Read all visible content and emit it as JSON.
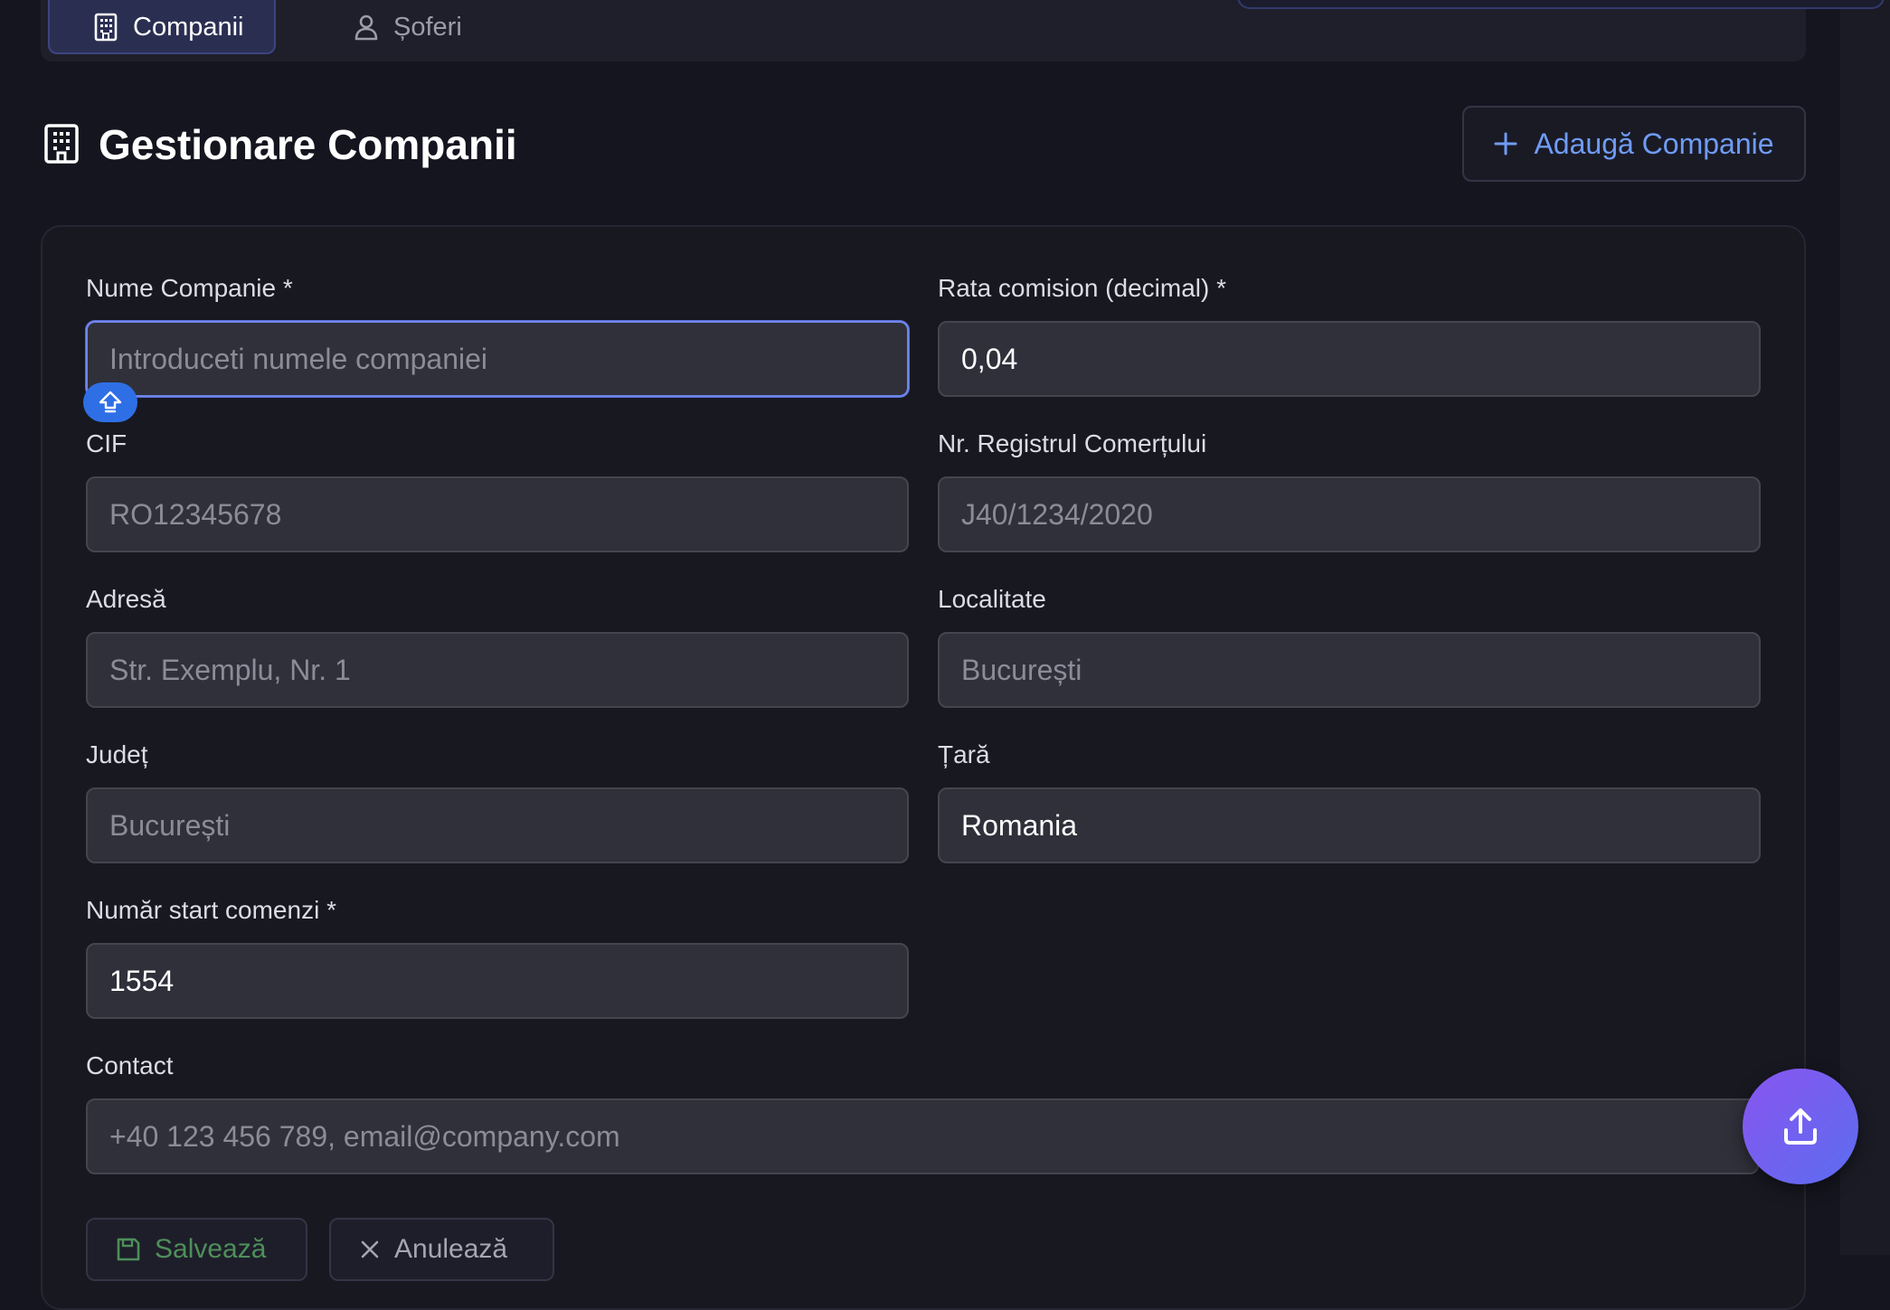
{
  "tabs": [
    {
      "label": "Companii",
      "icon": "building-icon",
      "active": true
    },
    {
      "label": "Șoferi",
      "icon": "user-icon",
      "active": false
    }
  ],
  "header": {
    "title": "Gestionare Companii",
    "icon": "building-icon",
    "add_button_label": "Adaugă Companie"
  },
  "form": {
    "company_name": {
      "label": "Nume Companie *",
      "value": "",
      "placeholder": "Introduceti numele companiei"
    },
    "commission_rate": {
      "label": "Rata comision (decimal) *",
      "value": "0,04",
      "placeholder": ""
    },
    "cif": {
      "label": "CIF",
      "value": "",
      "placeholder": "RO12345678"
    },
    "trade_register": {
      "label": "Nr. Registrul Comerțului",
      "value": "",
      "placeholder": "J40/1234/2020"
    },
    "address": {
      "label": "Adresă",
      "value": "",
      "placeholder": "Str. Exemplu, Nr. 1"
    },
    "city": {
      "label": "Localitate",
      "value": "",
      "placeholder": "București"
    },
    "county": {
      "label": "Județ",
      "value": "",
      "placeholder": "București"
    },
    "country": {
      "label": "Țară",
      "value": "Romania",
      "placeholder": ""
    },
    "order_start_number": {
      "label": "Număr start comenzi *",
      "value": "1554",
      "placeholder": ""
    },
    "contact": {
      "label": "Contact",
      "value": "",
      "placeholder": "+40 123 456 789, email@company.com"
    },
    "save_label": "Salvează",
    "cancel_label": "Anulează"
  },
  "colors": {
    "background": "#15151f",
    "accent": "#6f9cf5",
    "tab_active_bg": "#2a2f52",
    "fab_gradient_start": "#8a55f0",
    "fab_gradient_end": "#5b6df0"
  }
}
